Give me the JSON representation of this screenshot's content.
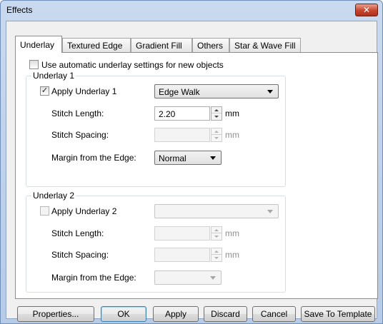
{
  "window": {
    "title": "Effects",
    "close_icon": "close-icon"
  },
  "tabs": [
    {
      "label": "Underlay",
      "active": true
    },
    {
      "label": "Textured Edge",
      "active": false
    },
    {
      "label": "Gradient Fill",
      "active": false
    },
    {
      "label": "Others",
      "active": false
    },
    {
      "label": "Star & Wave Fill",
      "active": false
    }
  ],
  "auto_setting": {
    "label": "Use automatic underlay settings for new objects",
    "checked": false
  },
  "underlay1": {
    "caption": "Underlay 1",
    "apply_label": "Apply Underlay 1",
    "apply_checked": true,
    "type_value": "Edge Walk",
    "stitch_length_label": "Stitch Length:",
    "stitch_length_value": "2.20",
    "stitch_length_unit": "mm",
    "stitch_spacing_label": "Stitch Spacing:",
    "stitch_spacing_value": "",
    "stitch_spacing_unit": "mm",
    "margin_label": "Margin from the Edge:",
    "margin_value": "Normal"
  },
  "underlay2": {
    "caption": "Underlay 2",
    "apply_label": "Apply Underlay 2",
    "apply_checked": false,
    "type_value": "",
    "stitch_length_label": "Stitch Length:",
    "stitch_length_unit": "mm",
    "stitch_spacing_label": "Stitch Spacing:",
    "stitch_spacing_unit": "mm",
    "margin_label": "Margin from the Edge:",
    "margin_value": ""
  },
  "buttons": {
    "properties": "Properties...",
    "ok": "OK",
    "apply": "Apply",
    "discard": "Discard",
    "cancel": "Cancel",
    "save_template": "Save To Template"
  }
}
